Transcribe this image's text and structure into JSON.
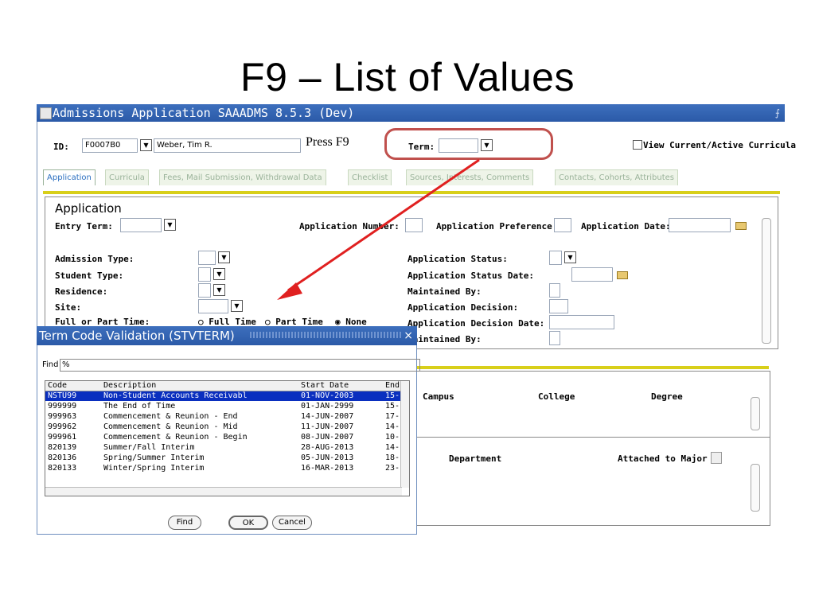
{
  "slide": {
    "title": "F9 – List of Values"
  },
  "window": {
    "title": "Admissions Application  SAAADMS  8.5.3  (Dev)"
  },
  "key_block": {
    "id_label": "ID:",
    "id_value": "F0007B0",
    "name_value": "Weber, Tim R.",
    "press_text": "Press F9",
    "term_label": "Term:",
    "term_value": "",
    "view_curricula_label": "View Current/Active Curricula"
  },
  "tabs": [
    {
      "label": "Application",
      "active": true
    },
    {
      "label": "Curricula"
    },
    {
      "label": "Fees, Mail Submission, Withdrawal Data"
    },
    {
      "label": "Checklist"
    },
    {
      "label": "Sources, Interests, Comments"
    },
    {
      "label": "Contacts, Cohorts, Attributes"
    }
  ],
  "application": {
    "section_title": "Application",
    "entry_term_label": "Entry Term:",
    "app_number_label": "Application Number:",
    "app_preference_label": "Application Preference:",
    "app_date_label": "Application Date:",
    "admission_type_label": "Admission Type:",
    "student_type_label": "Student Type:",
    "residence_label": "Residence:",
    "site_label": "Site:",
    "full_part_label": "Full or Part Time:",
    "full_time_label": "Full Time",
    "part_time_label": "Part Time",
    "none_label": "None",
    "app_status_label": "Application Status:",
    "app_status_date_label": "Application Status Date:",
    "maintained_by_label": "Maintained By:",
    "app_decision_label": "Application Decision:",
    "app_decision_date_label": "Application Decision Date:",
    "maintained_by2_label": "Maintained By:"
  },
  "curricula": {
    "campus_label": "Campus",
    "college_label": "College",
    "degree_label": "Degree"
  },
  "field_of_study": {
    "department_label": "Department",
    "attached_major_label": "Attached to Major"
  },
  "dialog": {
    "title": "Term Code Validation (STVTERM)",
    "close_glyph": "×",
    "find_label": "Find",
    "find_value": "%",
    "columns": [
      "Code",
      "Description",
      "Start Date",
      "End"
    ],
    "rows": [
      [
        "NSTU99",
        "Non-Student Accounts Receivabl",
        "01-NOV-2003",
        "15-"
      ],
      [
        "999999",
        "The End of Time",
        "01-JAN-2999",
        "15-"
      ],
      [
        "999963",
        "Commencement & Reunion - End",
        "14-JUN-2007",
        "17-"
      ],
      [
        "999962",
        "Commencement & Reunion - Mid",
        "11-JUN-2007",
        "14-"
      ],
      [
        "999961",
        "Commencement & Reunion - Begin",
        "08-JUN-2007",
        "10-"
      ],
      [
        "820139",
        "Summer/Fall Interim",
        "28-AUG-2013",
        "14-"
      ],
      [
        "820136",
        "Spring/Summer Interim",
        "05-JUN-2013",
        "18-"
      ],
      [
        "820133",
        "Winter/Spring Interim",
        "16-MAR-2013",
        "23-"
      ]
    ],
    "find_button": "Find",
    "ok_button": "OK",
    "cancel_button": "Cancel"
  },
  "icons": {
    "dropdown": "dropdown-arrow-icon",
    "calendar": "calendar-icon",
    "app_icon": "app-window-icon",
    "note": "note-icon"
  },
  "colors": {
    "titlebar": "#2b5aa8",
    "highlight": "#c0504d",
    "arrow": "#e02020",
    "yellowbar": "#d8cf1a",
    "selected_row": "#0a2fbf"
  }
}
